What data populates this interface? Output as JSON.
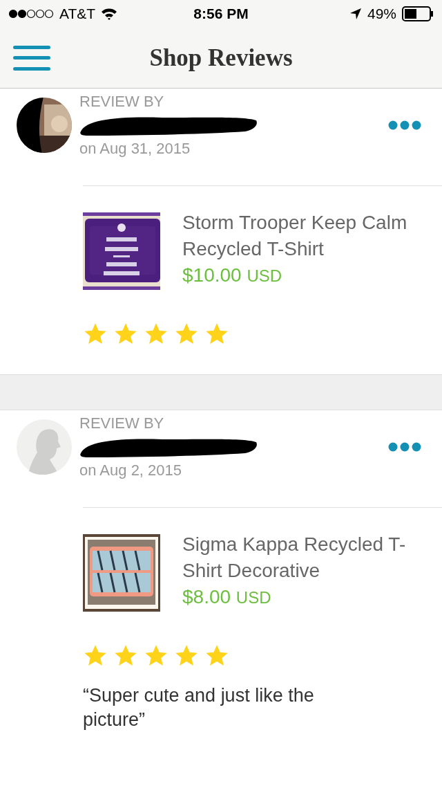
{
  "status_bar": {
    "carrier": "AT&T",
    "time": "8:56 PM",
    "battery": "49%"
  },
  "nav": {
    "title": "Shop Reviews"
  },
  "reviews": [
    {
      "label": "REVIEW BY",
      "date": "on Aug 31, 2015",
      "product": {
        "title": "Storm Trooper Keep Calm Recycled T-Shirt",
        "price": "$10.00",
        "currency": "USD"
      },
      "stars": 5
    },
    {
      "label": "REVIEW BY",
      "avatar": {
        "kind": "silhouette"
      },
      "date": "on Aug 2, 2015",
      "product": {
        "title": "Sigma Kappa Recycled T-Shirt Decorative",
        "price": "$8.00",
        "currency": "USD"
      },
      "stars": 5,
      "quote": "“Super cute and just like the picture”"
    }
  ]
}
